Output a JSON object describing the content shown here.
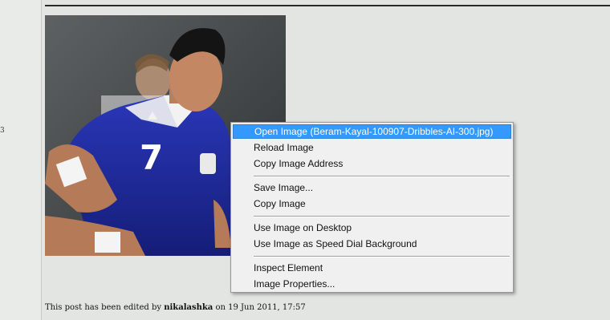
{
  "gutter": {
    "marker": "3"
  },
  "post": {
    "edit_prefix": "This post has been edited by",
    "editor": "nikalashka",
    "edit_on": "on",
    "edit_date": "19 Jun 2011, 17:57"
  },
  "photo": {
    "jersey_number": "7",
    "kit_color": "#1f2b99"
  },
  "context_menu": {
    "items": [
      {
        "label": "Open Image (Beram-Kayal-100907-Dribbles-AI-300.jpg)"
      },
      {
        "label": "Reload Image"
      },
      {
        "label": "Copy Image Address"
      },
      {
        "label": "Save Image..."
      },
      {
        "label": "Copy Image"
      },
      {
        "label": "Use Image on Desktop"
      },
      {
        "label": "Use Image as Speed Dial Background"
      },
      {
        "label": "Inspect Element"
      },
      {
        "label": "Image Properties..."
      }
    ],
    "highlight_color": "#3399ff"
  }
}
